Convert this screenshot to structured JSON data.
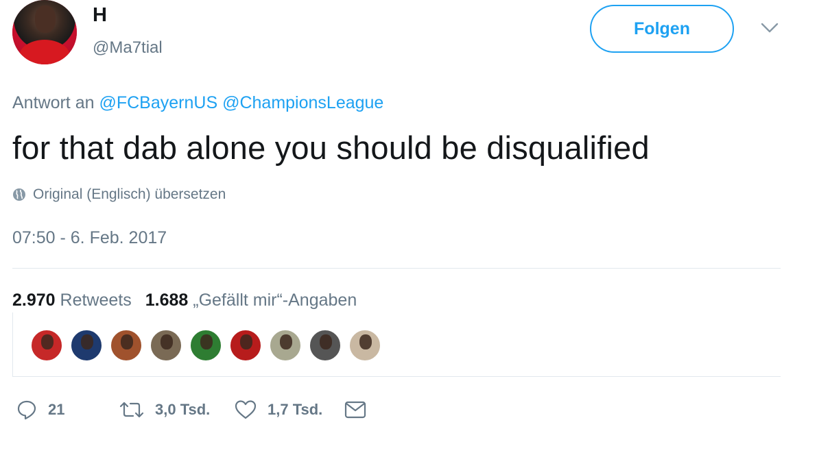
{
  "user": {
    "name": "H",
    "handle": "@Ma7tial",
    "avatar_color": "#d71920"
  },
  "header": {
    "follow_label": "Folgen",
    "menu_icon": "chevron-down-icon",
    "accent": "#1da1f2"
  },
  "reply": {
    "prefix": "Antwort an",
    "mentions": [
      "@FCBayernUS",
      "@ChampionsLeague"
    ]
  },
  "tweet": {
    "text": "for that dab alone you should be disqualified",
    "translate_label": "Original (Englisch) übersetzen",
    "translate_icon": "globe-icon",
    "timestamp": "07:50 - 6. Feb. 2017"
  },
  "stats": {
    "retweets_count": "2.970",
    "retweets_label": "Retweets",
    "likes_count": "1.688",
    "likes_label": "„Gefällt mir“-Angaben"
  },
  "likers": [
    {
      "icon": "liker-avatar",
      "color": "#c62828"
    },
    {
      "icon": "liker-avatar",
      "color": "#1e3a6e"
    },
    {
      "icon": "liker-avatar",
      "color": "#a0522d"
    },
    {
      "icon": "liker-avatar",
      "color": "#7a6a55"
    },
    {
      "icon": "liker-avatar",
      "color": "#2e7d32"
    },
    {
      "icon": "liker-avatar",
      "color": "#b71c1c"
    },
    {
      "icon": "liker-avatar",
      "color": "#a8a890"
    },
    {
      "icon": "liker-avatar",
      "color": "#555555"
    },
    {
      "icon": "liker-avatar",
      "color": "#c9b8a2"
    }
  ],
  "actions": {
    "reply_count": "21",
    "retweet_count": "3,0 Tsd.",
    "like_count": "1,7 Tsd."
  }
}
